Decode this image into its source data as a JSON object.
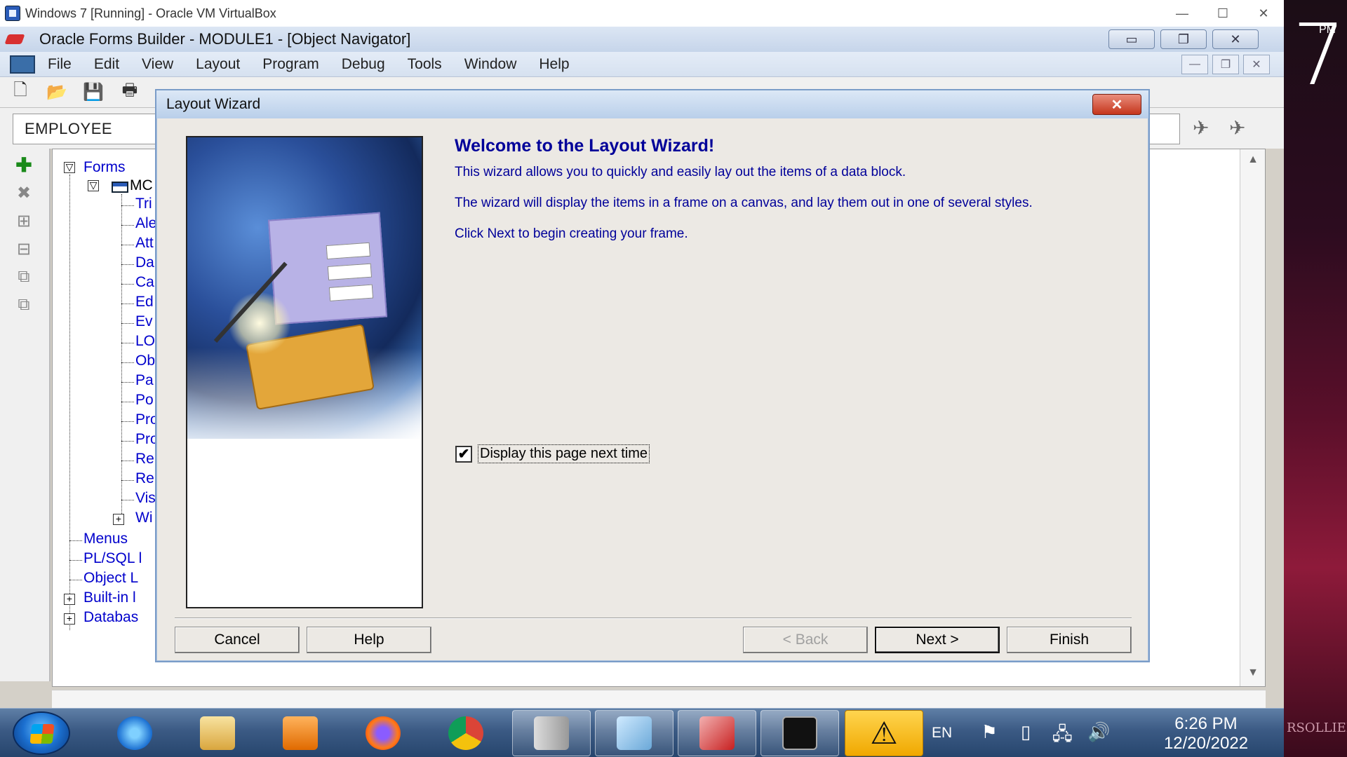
{
  "host": {
    "title": "Windows 7 [Running] - Oracle VM VirtualBox",
    "minimize": "—",
    "maximize": "☐",
    "close": "✕"
  },
  "forms_app": {
    "title": "Oracle Forms Builder - MODULE1 - [Object Navigator]",
    "menu": [
      "File",
      "Edit",
      "View",
      "Layout",
      "Program",
      "Debug",
      "Tools",
      "Window",
      "Help"
    ],
    "search_value": "EMPLOYEE",
    "tree": {
      "forms": "Forms",
      "module": "MC",
      "children": [
        "Tri",
        "Ale",
        "Att",
        "Da",
        "Ca",
        "Ed",
        "Ev",
        "LO",
        "Ob",
        "Pa",
        "Po",
        "Pro",
        "Pro",
        "Re",
        "Re",
        "Vis",
        "Wi"
      ],
      "menus": "Menus",
      "plsql": "PL/SQL l",
      "object_lib": "Object L",
      "builtin": "Built-in l",
      "database": "Databas"
    }
  },
  "wizard": {
    "title": "Layout Wizard",
    "close": "✕",
    "heading": "Welcome to the Layout Wizard!",
    "para1": "This wizard allows you to quickly and easily lay out the items of a data block.",
    "para2": "The wizard will display the items in a frame on a canvas, and lay them out in one of several styles.",
    "para3": "Click Next to begin creating your frame.",
    "checkbox_label": "Display this page next time",
    "checkbox_checked": true,
    "buttons": {
      "cancel": "Cancel",
      "help": "Help",
      "back": "< Back",
      "next": "Next >",
      "finish": "Finish"
    }
  },
  "taskbar": {
    "language": "EN",
    "time": "6:26 PM",
    "date": "12/20/2022"
  },
  "desktop": {
    "clock_digit": "7",
    "clock_ampm": "PM",
    "signature": "RSOLLIER"
  }
}
